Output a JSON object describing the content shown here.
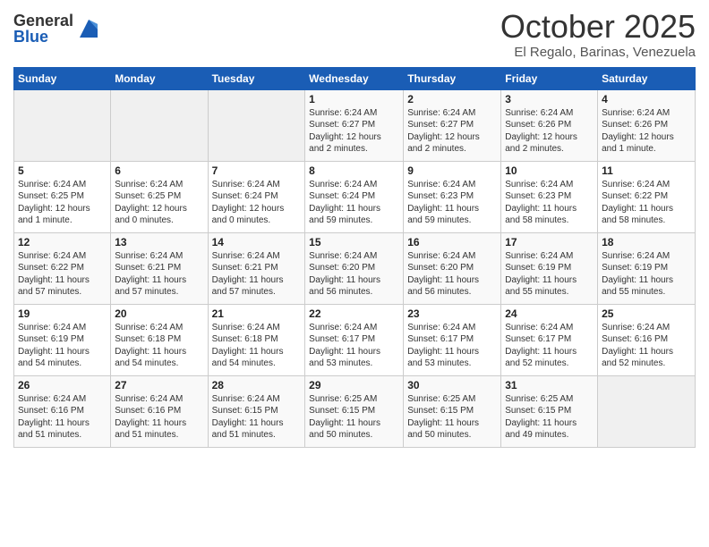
{
  "header": {
    "logo_general": "General",
    "logo_blue": "Blue",
    "month_title": "October 2025",
    "location": "El Regalo, Barinas, Venezuela"
  },
  "days_of_week": [
    "Sunday",
    "Monday",
    "Tuesday",
    "Wednesday",
    "Thursday",
    "Friday",
    "Saturday"
  ],
  "weeks": [
    [
      {
        "day": "",
        "info": ""
      },
      {
        "day": "",
        "info": ""
      },
      {
        "day": "",
        "info": ""
      },
      {
        "day": "1",
        "info": "Sunrise: 6:24 AM\nSunset: 6:27 PM\nDaylight: 12 hours\nand 2 minutes."
      },
      {
        "day": "2",
        "info": "Sunrise: 6:24 AM\nSunset: 6:27 PM\nDaylight: 12 hours\nand 2 minutes."
      },
      {
        "day": "3",
        "info": "Sunrise: 6:24 AM\nSunset: 6:26 PM\nDaylight: 12 hours\nand 2 minutes."
      },
      {
        "day": "4",
        "info": "Sunrise: 6:24 AM\nSunset: 6:26 PM\nDaylight: 12 hours\nand 1 minute."
      }
    ],
    [
      {
        "day": "5",
        "info": "Sunrise: 6:24 AM\nSunset: 6:25 PM\nDaylight: 12 hours\nand 1 minute."
      },
      {
        "day": "6",
        "info": "Sunrise: 6:24 AM\nSunset: 6:25 PM\nDaylight: 12 hours\nand 0 minutes."
      },
      {
        "day": "7",
        "info": "Sunrise: 6:24 AM\nSunset: 6:24 PM\nDaylight: 12 hours\nand 0 minutes."
      },
      {
        "day": "8",
        "info": "Sunrise: 6:24 AM\nSunset: 6:24 PM\nDaylight: 11 hours\nand 59 minutes."
      },
      {
        "day": "9",
        "info": "Sunrise: 6:24 AM\nSunset: 6:23 PM\nDaylight: 11 hours\nand 59 minutes."
      },
      {
        "day": "10",
        "info": "Sunrise: 6:24 AM\nSunset: 6:23 PM\nDaylight: 11 hours\nand 58 minutes."
      },
      {
        "day": "11",
        "info": "Sunrise: 6:24 AM\nSunset: 6:22 PM\nDaylight: 11 hours\nand 58 minutes."
      }
    ],
    [
      {
        "day": "12",
        "info": "Sunrise: 6:24 AM\nSunset: 6:22 PM\nDaylight: 11 hours\nand 57 minutes."
      },
      {
        "day": "13",
        "info": "Sunrise: 6:24 AM\nSunset: 6:21 PM\nDaylight: 11 hours\nand 57 minutes."
      },
      {
        "day": "14",
        "info": "Sunrise: 6:24 AM\nSunset: 6:21 PM\nDaylight: 11 hours\nand 57 minutes."
      },
      {
        "day": "15",
        "info": "Sunrise: 6:24 AM\nSunset: 6:20 PM\nDaylight: 11 hours\nand 56 minutes."
      },
      {
        "day": "16",
        "info": "Sunrise: 6:24 AM\nSunset: 6:20 PM\nDaylight: 11 hours\nand 56 minutes."
      },
      {
        "day": "17",
        "info": "Sunrise: 6:24 AM\nSunset: 6:19 PM\nDaylight: 11 hours\nand 55 minutes."
      },
      {
        "day": "18",
        "info": "Sunrise: 6:24 AM\nSunset: 6:19 PM\nDaylight: 11 hours\nand 55 minutes."
      }
    ],
    [
      {
        "day": "19",
        "info": "Sunrise: 6:24 AM\nSunset: 6:19 PM\nDaylight: 11 hours\nand 54 minutes."
      },
      {
        "day": "20",
        "info": "Sunrise: 6:24 AM\nSunset: 6:18 PM\nDaylight: 11 hours\nand 54 minutes."
      },
      {
        "day": "21",
        "info": "Sunrise: 6:24 AM\nSunset: 6:18 PM\nDaylight: 11 hours\nand 54 minutes."
      },
      {
        "day": "22",
        "info": "Sunrise: 6:24 AM\nSunset: 6:17 PM\nDaylight: 11 hours\nand 53 minutes."
      },
      {
        "day": "23",
        "info": "Sunrise: 6:24 AM\nSunset: 6:17 PM\nDaylight: 11 hours\nand 53 minutes."
      },
      {
        "day": "24",
        "info": "Sunrise: 6:24 AM\nSunset: 6:17 PM\nDaylight: 11 hours\nand 52 minutes."
      },
      {
        "day": "25",
        "info": "Sunrise: 6:24 AM\nSunset: 6:16 PM\nDaylight: 11 hours\nand 52 minutes."
      }
    ],
    [
      {
        "day": "26",
        "info": "Sunrise: 6:24 AM\nSunset: 6:16 PM\nDaylight: 11 hours\nand 51 minutes."
      },
      {
        "day": "27",
        "info": "Sunrise: 6:24 AM\nSunset: 6:16 PM\nDaylight: 11 hours\nand 51 minutes."
      },
      {
        "day": "28",
        "info": "Sunrise: 6:24 AM\nSunset: 6:15 PM\nDaylight: 11 hours\nand 51 minutes."
      },
      {
        "day": "29",
        "info": "Sunrise: 6:25 AM\nSunset: 6:15 PM\nDaylight: 11 hours\nand 50 minutes."
      },
      {
        "day": "30",
        "info": "Sunrise: 6:25 AM\nSunset: 6:15 PM\nDaylight: 11 hours\nand 50 minutes."
      },
      {
        "day": "31",
        "info": "Sunrise: 6:25 AM\nSunset: 6:15 PM\nDaylight: 11 hours\nand 49 minutes."
      },
      {
        "day": "",
        "info": ""
      }
    ]
  ]
}
